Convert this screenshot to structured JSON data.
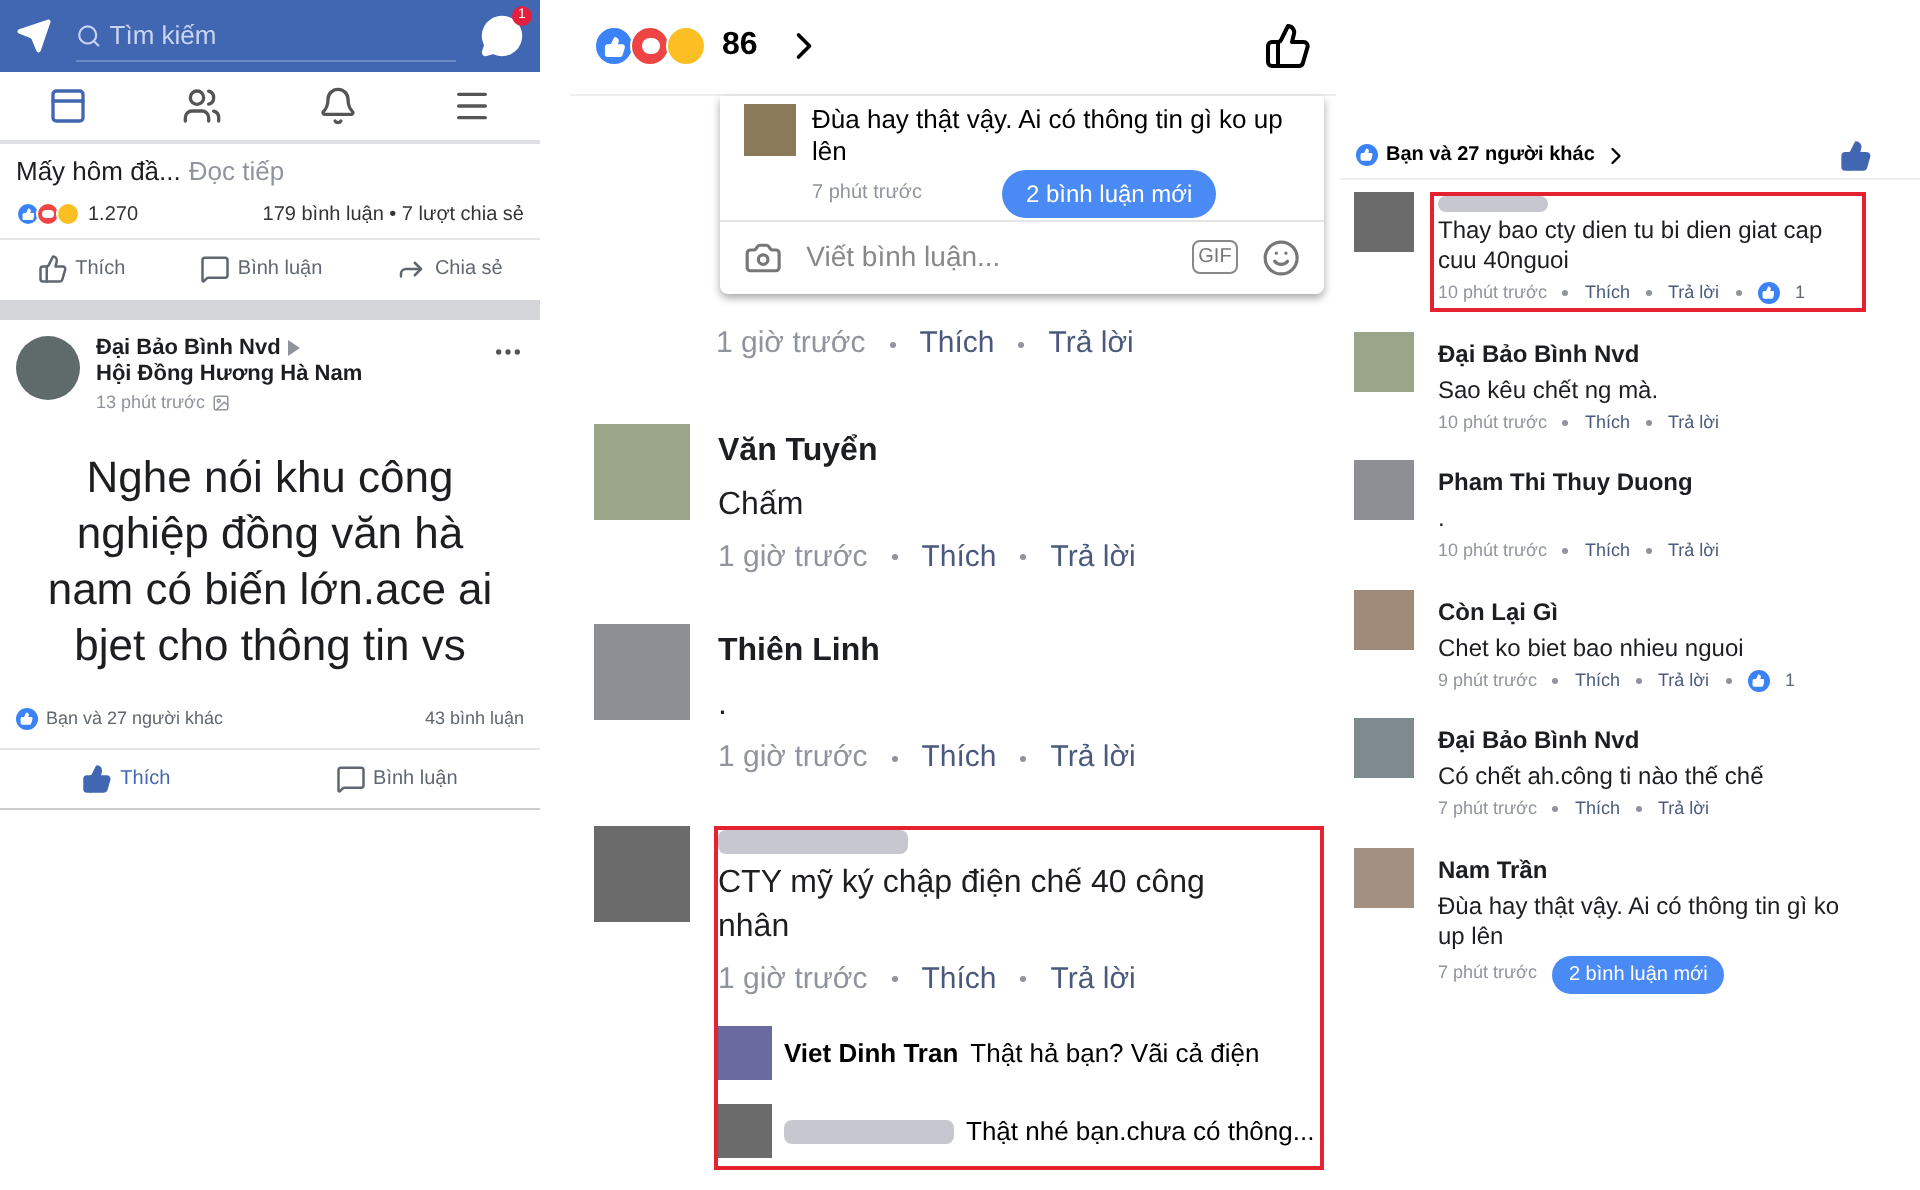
{
  "left": {
    "search": {
      "placeholder": "Tìm kiếm"
    },
    "messenger_badge": "1",
    "nav_tabs": [
      {
        "kind": "feed",
        "selected": true
      },
      {
        "kind": "friends",
        "selected": false
      },
      {
        "kind": "notifications",
        "selected": false
      },
      {
        "kind": "menu",
        "selected": false
      }
    ],
    "previous_post": {
      "snippet": "Mấy hôm đầ...",
      "read_more": "Đọc tiếp",
      "reaction_count": "1.270",
      "stats": "179 bình luận • 7 lượt chia sẻ",
      "actions": [
        {
          "kind": "like",
          "label": "Thích"
        },
        {
          "kind": "comment",
          "label": "Bình luận"
        },
        {
          "kind": "share",
          "label": "Chia sẻ"
        }
      ]
    },
    "post": {
      "author": "Đại Bảo Bình Nvd",
      "group": "Hội Đồng Hương Hà Nam",
      "time": "13 phút trước",
      "text": "Nghe nói khu công nghiệp đồng văn hà nam có biến lớn.ace ai bjet cho thông tin vs",
      "likes": "Bạn và 27 người khác",
      "comments": "43 bình luận",
      "actions": [
        {
          "kind": "like",
          "label": "Thích",
          "selected": true
        },
        {
          "kind": "comment",
          "label": "Bình luận",
          "selected": false
        }
      ]
    }
  },
  "middle": {
    "reaction_count": "86",
    "popup": {
      "comment_text": "Đùa hay thật vậy. Ai có thông tin gì ko up lên",
      "new_comments": "2 bình luận mới",
      "time": "7 phút trước",
      "input_placeholder": "Viết bình luận...",
      "gif": "GIF"
    },
    "comments": [
      {
        "time": "1 giờ trước",
        "like": "Thích",
        "reply": "Trả lời",
        "highlighted": false
      },
      {
        "name": "Văn Tuyển",
        "name_blurred": false,
        "text": "Chấm",
        "time": "1 giờ trước",
        "like": "Thích",
        "reply": "Trả lời",
        "highlighted": false
      },
      {
        "name": "Thiên Linh",
        "name_blurred": false,
        "text": ".",
        "time": "1 giờ trước",
        "like": "Thích",
        "reply": "Trả lời",
        "highlighted": false
      },
      {
        "name_blurred": true,
        "text": "CTY mỹ ký chập điện chế 40 công nhân",
        "time": "1 giờ trước",
        "like": "Thích",
        "reply": "Trả lời",
        "highlighted": true,
        "replies": [
          {
            "name": "Viet Dinh Tran",
            "name_blurred": false,
            "text": "Thật hả bạn? Vãi cả điện"
          },
          {
            "name_blurred": true,
            "text": "Thật nhé bạn.chưa có thông..."
          }
        ]
      }
    ]
  },
  "right": {
    "likes": "Bạn và 27 người khác",
    "comments": [
      {
        "name_blurred": true,
        "text": "Thay bao cty dien tu bi dien giat cap cuu 40nguoi",
        "time": "10 phút trước",
        "like": "Thích",
        "reply": "Trả lời",
        "like_count": "1",
        "highlighted": true
      },
      {
        "name": "Đại Bảo Bình Nvd",
        "name_blurred": false,
        "text": "Sao kêu chết ng mà.",
        "time": "10 phút trước",
        "like": "Thích",
        "reply": "Trả lời",
        "highlighted": false
      },
      {
        "name": "Pham Thi Thuy Duong",
        "name_blurred": false,
        "text": ".",
        "time": "10 phút trước",
        "like": "Thích",
        "reply": "Trả lời",
        "highlighted": false
      },
      {
        "name": "Còn Lại Gì",
        "name_blurred": false,
        "text": "Chet ko biet bao nhieu nguoi",
        "time": "9 phút trước",
        "like": "Thích",
        "reply": "Trả lời",
        "like_count": "1",
        "highlighted": false
      },
      {
        "name": "Đại Bảo Bình Nvd",
        "name_blurred": false,
        "text": "Có chết ah.công ti nào thế chế",
        "time": "7 phút trước",
        "like": "Thích",
        "reply": "Trả lời",
        "highlighted": false
      },
      {
        "name": "Nam Trần",
        "name_blurred": false,
        "text": "Đùa hay thật vậy. Ai có thông tin gì ko up lên",
        "time": "7 phút trước",
        "highlighted": false,
        "new_comments": "2 bình luận mới"
      }
    ]
  }
}
